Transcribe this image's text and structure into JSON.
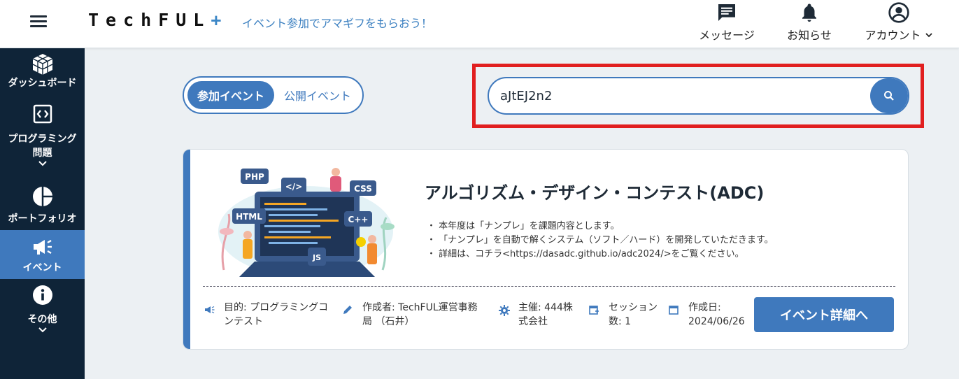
{
  "header": {
    "logo_text": "TechFUL",
    "logo_plus": "+",
    "tagline": "イベント参加でアマギフをもらおう！",
    "nav": [
      {
        "label": "メッセージ",
        "icon": "message-icon"
      },
      {
        "label": "お知らせ",
        "icon": "bell-icon"
      },
      {
        "label": "アカウント",
        "icon": "account-icon"
      }
    ]
  },
  "sidebar": {
    "items": [
      {
        "label": "ダッシュボード",
        "icon": "cube-icon"
      },
      {
        "label": "プログラミング問題",
        "icon": "code-icon"
      },
      {
        "label": "ポートフォリオ",
        "icon": "pie-chart-icon"
      },
      {
        "label": "イベント",
        "icon": "megaphone-icon",
        "active": true
      },
      {
        "label": "その他",
        "icon": "info-icon"
      }
    ]
  },
  "toggle": {
    "active_label": "参加イベント",
    "inactive_label": "公開イベント"
  },
  "search": {
    "value": "aJtEJ2n2"
  },
  "event": {
    "title": "アルゴリズム・デザイン・コンテスト(ADC)",
    "description": [
      "・ 本年度は「ナンプレ」を課題内容とします。",
      "・ 「ナンプレ」を自動で解くシステム（ソフト／ハード）を開発していただきます。",
      "・ 詳細は、コチラ<https://dasadc.github.io/adc2024/>をご覧ください。"
    ],
    "meta": {
      "purpose": "目的: プログラミングコンテスト",
      "author": "作成者: TechFUL運営事務局 （石井）",
      "sponsor": "主催: 444株式会社",
      "sessions": "セッション数: 1",
      "created": "作成日: 2024/06/26"
    },
    "detail_button": "イベント詳細へ",
    "illustration_tags": [
      "PHP",
      "CSS",
      "HTML",
      "C++",
      "JS",
      "</>"
    ]
  }
}
